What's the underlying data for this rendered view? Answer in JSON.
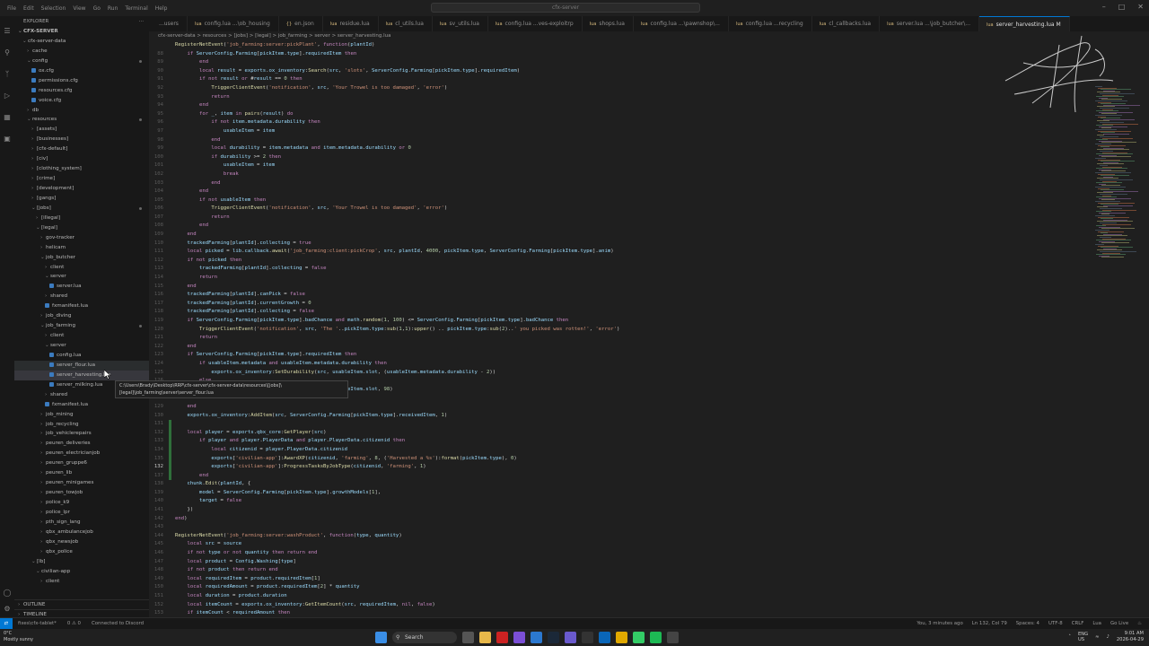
{
  "titlebar": {
    "menu": [
      "File",
      "Edit",
      "Selection",
      "View",
      "Go",
      "Run",
      "Terminal",
      "Help"
    ],
    "search": "cfx-server"
  },
  "explorer": {
    "title": "EXPLORER",
    "root": "CFX-SERVER",
    "items": [
      {
        "label": "cfx-server-data",
        "depth": 1,
        "chev": "v"
      },
      {
        "label": "cache",
        "depth": 2,
        "chev": ">"
      },
      {
        "label": "config",
        "depth": 2,
        "chev": "v"
      },
      {
        "label": "ox.cfg",
        "depth": 3,
        "chev": ""
      },
      {
        "label": "permissions.cfg",
        "depth": 3,
        "chev": ""
      },
      {
        "label": "resources.cfg",
        "depth": 3,
        "chev": ""
      },
      {
        "label": "voice.cfg",
        "depth": 3,
        "chev": ""
      },
      {
        "label": "db",
        "depth": 2,
        "chev": ">"
      },
      {
        "label": "resources",
        "depth": 2,
        "chev": "v"
      },
      {
        "label": "[assets]",
        "depth": 3,
        "chev": ">"
      },
      {
        "label": "[businesses]",
        "depth": 3,
        "chev": ">"
      },
      {
        "label": "[cfx-default]",
        "depth": 3,
        "chev": ">"
      },
      {
        "label": "[civ]",
        "depth": 3,
        "chev": ">"
      },
      {
        "label": "[clothing_system]",
        "depth": 3,
        "chev": ">"
      },
      {
        "label": "[crime]",
        "depth": 3,
        "chev": ">"
      },
      {
        "label": "[development]",
        "depth": 3,
        "chev": ">"
      },
      {
        "label": "[gangs]",
        "depth": 3,
        "chev": ">"
      },
      {
        "label": "[jobs]",
        "depth": 3,
        "chev": "v"
      },
      {
        "label": "[illegal]",
        "depth": 4,
        "chev": ">"
      },
      {
        "label": "[legal]",
        "depth": 4,
        "chev": "v"
      },
      {
        "label": "gov-tracker",
        "depth": 5,
        "chev": ">"
      },
      {
        "label": "helicam",
        "depth": 5,
        "chev": ">"
      },
      {
        "label": "job_butcher",
        "depth": 5,
        "chev": "v"
      },
      {
        "label": "client",
        "depth": 6,
        "chev": ">"
      },
      {
        "label": "server",
        "depth": 6,
        "chev": "v"
      },
      {
        "label": "server.lua",
        "depth": 7,
        "chev": ""
      },
      {
        "label": "shared",
        "depth": 6,
        "chev": ">"
      },
      {
        "label": "fxmanifest.lua",
        "depth": 6,
        "chev": ""
      },
      {
        "label": "job_diving",
        "depth": 5,
        "chev": ">"
      },
      {
        "label": "job_farming",
        "depth": 5,
        "chev": "v"
      },
      {
        "label": "client",
        "depth": 6,
        "chev": ">"
      },
      {
        "label": "server",
        "depth": 6,
        "chev": "v"
      },
      {
        "label": "config.lua",
        "depth": 7,
        "chev": ""
      },
      {
        "label": "server_flour.lua",
        "depth": 7,
        "chev": ""
      },
      {
        "label": "server_harvesting.lua",
        "depth": 7,
        "chev": ""
      },
      {
        "label": "server_milking.lua",
        "depth": 7,
        "chev": ""
      },
      {
        "label": "shared",
        "depth": 6,
        "chev": ">"
      },
      {
        "label": "fxmanifest.lua",
        "depth": 6,
        "chev": ""
      },
      {
        "label": "job_mining",
        "depth": 5,
        "chev": ">"
      },
      {
        "label": "job_recycling",
        "depth": 5,
        "chev": ">"
      },
      {
        "label": "job_vehiclerepairs",
        "depth": 5,
        "chev": ">"
      },
      {
        "label": "peuren_deliveries",
        "depth": 5,
        "chev": ">"
      },
      {
        "label": "peuren_electricianjob",
        "depth": 5,
        "chev": ">"
      },
      {
        "label": "peuren_gruppe6",
        "depth": 5,
        "chev": ">"
      },
      {
        "label": "peuren_lib",
        "depth": 5,
        "chev": ">"
      },
      {
        "label": "peuren_minigames",
        "depth": 5,
        "chev": ">"
      },
      {
        "label": "peuren_towjob",
        "depth": 5,
        "chev": ">"
      },
      {
        "label": "police_k9",
        "depth": 5,
        "chev": ">"
      },
      {
        "label": "police_lpr",
        "depth": 5,
        "chev": ">"
      },
      {
        "label": "pth_sign_lang",
        "depth": 5,
        "chev": ">"
      },
      {
        "label": "qbx_ambulancejob",
        "depth": 5,
        "chev": ">"
      },
      {
        "label": "qbx_newsjob",
        "depth": 5,
        "chev": ">"
      },
      {
        "label": "qbx_police",
        "depth": 5,
        "chev": ">"
      },
      {
        "label": "[lb]",
        "depth": 3,
        "chev": "v"
      },
      {
        "label": "civilian-app",
        "depth": 4,
        "chev": "v"
      },
      {
        "label": "client",
        "depth": 5,
        "chev": ">"
      }
    ],
    "outline": "OUTLINE",
    "timeline": "TIMELINE",
    "tooltip_line1": "C:\\Users\\Brady\\Desktop\\RRP\\cfx-server\\cfx-server-data\\resources\\[jobs]\\",
    "tooltip_line2": "[legal]\\job_farming\\server\\server_flour.lua"
  },
  "tabs": [
    {
      "label": "...users",
      "icon": ""
    },
    {
      "label": "config.lua ...\\ob_housing",
      "icon": "lua"
    },
    {
      "label": "en.json",
      "icon": "{}"
    },
    {
      "label": "residue.lua",
      "icon": "lua"
    },
    {
      "label": "cl_utils.lua",
      "icon": "lua"
    },
    {
      "label": "sv_utils.lua",
      "icon": "lua"
    },
    {
      "label": "config.lua ...ves-exploitrp",
      "icon": "lua"
    },
    {
      "label": "shops.lua",
      "icon": "lua"
    },
    {
      "label": "config.lua ...\\pawnshop\\...",
      "icon": "lua"
    },
    {
      "label": "config.lua ...recycling",
      "icon": "lua"
    },
    {
      "label": "cl_callbacks.lua",
      "icon": "lua"
    },
    {
      "label": "server.lua ...\\job_butcher\\...",
      "icon": "lua"
    },
    {
      "label": "server_harvesting.lua M",
      "icon": "lua",
      "active": true
    }
  ],
  "breadcrumb": "cfx-server-data > resources > [jobs] > [legal] > job_farming > server > server_harvesting.lua",
  "code_lines": [
    {
      "n": "",
      "t": "RegisterNetEvent('job_farming:server:pickPlant', function(plantId)"
    },
    {
      "n": "88",
      "t": "    if ServerConfig.Farming[pickItem.type].requiredItem then"
    },
    {
      "n": "89",
      "t": "        end"
    },
    {
      "n": "90",
      "t": "        local result = exports.ox_inventory:Search(src, 'slots', ServerConfig.Farming[pickItem.type].requiredItem)"
    },
    {
      "n": "91",
      "t": "        if not result or #result == 0 then"
    },
    {
      "n": "92",
      "t": "            TriggerClientEvent('notification', src, 'Your Trowel is too damaged', 'error')"
    },
    {
      "n": "93",
      "t": "            return"
    },
    {
      "n": "94",
      "t": "        end"
    },
    {
      "n": "95",
      "t": "        for _, item in pairs(result) do"
    },
    {
      "n": "96",
      "t": "            if not item.metadata.durability then"
    },
    {
      "n": "97",
      "t": "                usableItem = item"
    },
    {
      "n": "98",
      "t": "            end"
    },
    {
      "n": "99",
      "t": "            local durability = item.metadata and item.metadata.durability or 0"
    },
    {
      "n": "100",
      "t": "            if durability >= 2 then"
    },
    {
      "n": "101",
      "t": "                usableItem = item"
    },
    {
      "n": "102",
      "t": "                break"
    },
    {
      "n": "103",
      "t": "            end"
    },
    {
      "n": "104",
      "t": "        end"
    },
    {
      "n": "105",
      "t": "        if not usableItem then"
    },
    {
      "n": "106",
      "t": "            TriggerClientEvent('notification', src, 'Your Trowel is too damaged', 'error')"
    },
    {
      "n": "107",
      "t": "            return"
    },
    {
      "n": "108",
      "t": "        end"
    },
    {
      "n": "109",
      "t": "    end"
    },
    {
      "n": "110",
      "t": "    trackedFarming[plantId].collecting = true"
    },
    {
      "n": "111",
      "t": "    local picked = lib.callback.await('job_farming:client:pickCrop', src, plantId, 4000, pickItem.type, ServerConfig.Farming[pickItem.type].anim)"
    },
    {
      "n": "112",
      "t": "    if not picked then"
    },
    {
      "n": "113",
      "t": "        trackedFarming[plantId].collecting = false"
    },
    {
      "n": "114",
      "t": "        return"
    },
    {
      "n": "115",
      "t": "    end"
    },
    {
      "n": "116",
      "t": "    trackedFarming[plantId].canPick = false"
    },
    {
      "n": "117",
      "t": "    trackedFarming[plantId].currentGrowth = 0"
    },
    {
      "n": "118",
      "t": "    trackedFarming[plantId].collecting = false"
    },
    {
      "n": "119",
      "t": "    if ServerConfig.Farming[pickItem.type].badChance and math.random(1, 100) <= ServerConfig.Farming[pickItem.type].badChance then"
    },
    {
      "n": "120",
      "t": "        TriggerClientEvent('notification', src, 'The '..pickItem.type:sub(1,1):upper() .. pickItem.type:sub(2)..' you picked was rotten!', 'error')"
    },
    {
      "n": "121",
      "t": "        return"
    },
    {
      "n": "122",
      "t": "    end"
    },
    {
      "n": "123",
      "t": "    if ServerConfig.Farming[pickItem.type].requiredItem then"
    },
    {
      "n": "124",
      "t": "        if usableItem.metadata and usableItem.metadata.durability then"
    },
    {
      "n": "125",
      "t": "            exports.ox_inventory:SetDurability(src, usableItem.slot, (usableItem.metadata.durability - 2))"
    },
    {
      "n": "126",
      "t": "        else"
    },
    {
      "n": "127",
      "t": "            exports.ox_inventory:SetDurability(src, usableItem.slot, 98)"
    },
    {
      "n": "128",
      "t": "        end"
    },
    {
      "n": "129",
      "t": "    end"
    },
    {
      "n": "130",
      "t": "    exports.ox_inventory:AddItem(src, ServerConfig.Farming[pickItem.type].receivedItem, 1)"
    },
    {
      "n": "131",
      "t": ""
    },
    {
      "n": "132",
      "t": "    local player = exports.qbx_core:GetPlayer(src)"
    },
    {
      "n": "133",
      "t": "        if player and player.PlayerData and player.PlayerData.citizenid then"
    },
    {
      "n": "134",
      "t": "            local citizenid = player.PlayerData.citizenid"
    },
    {
      "n": "135",
      "t": "            exports['civilian-app']:AwardXP(citizenid, 'farming', 8, ('Harvested a %s'):format(pickItem.type), 0)"
    },
    {
      "n": "132",
      "t": "            exports['civilian-app']:ProgressTasksByJobType(citizenid, 'farming', 1)",
      "cur": true
    },
    {
      "n": "137",
      "t": "        end"
    },
    {
      "n": "138",
      "t": "    chunk.Edit(plantId, {"
    },
    {
      "n": "139",
      "t": "        model = ServerConfig.Farming[pickItem.type].growthModels[1],"
    },
    {
      "n": "140",
      "t": "        target = false"
    },
    {
      "n": "141",
      "t": "    })"
    },
    {
      "n": "142",
      "t": "end)"
    },
    {
      "n": "143",
      "t": ""
    },
    {
      "n": "144",
      "t": "RegisterNetEvent('job_farming:server:washProduct', function(type, quantity)"
    },
    {
      "n": "145",
      "t": "    local src = source"
    },
    {
      "n": "146",
      "t": "    if not type or not quantity then return end"
    },
    {
      "n": "147",
      "t": "    local product = Config.Washing[type]"
    },
    {
      "n": "148",
      "t": "    if not product then return end"
    },
    {
      "n": "149",
      "t": "    local requiredItem = product.requiredItem[1]"
    },
    {
      "n": "150",
      "t": "    local requiredAmount = product.requiredItem[2] * quantity"
    },
    {
      "n": "151",
      "t": "    local duration = product.duration"
    },
    {
      "n": "152",
      "t": "    local itemCount = exports.ox_inventory:GetItemCount(src, requiredItem, nil, false)"
    },
    {
      "n": "153",
      "t": "    if itemCount < requiredAmount then"
    }
  ],
  "statusbar": {
    "branch": "fixes\\cfx-tablet*",
    "problems": "0 ⚠ 0",
    "discord": "Connected to Discord",
    "blame": "You, 3 minutes ago",
    "position": "Ln 132, Col 79",
    "spaces": "Spaces: 4",
    "encoding": "UTF-8",
    "eol": "CRLF",
    "language": "Lua",
    "golive": "Go Live"
  },
  "taskbar": {
    "temp": "0°C",
    "weather": "Mostly sunny",
    "search": "Search",
    "lang": "ENG",
    "region": "US",
    "time": "9:01 AM",
    "date": "2026-04-29"
  },
  "colors": {
    "accent": "#0078d4",
    "keyword": "#c586c0",
    "function": "#dcdcaa",
    "string": "#ce9178",
    "number": "#b5cea8",
    "identifier": "#9cdcfe"
  }
}
